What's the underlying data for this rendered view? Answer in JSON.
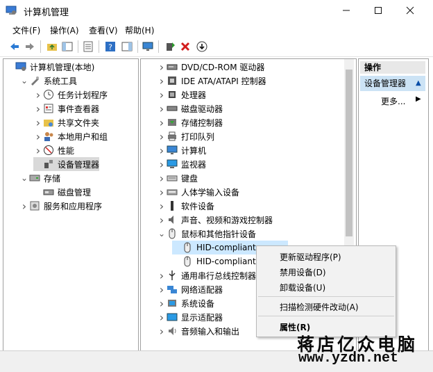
{
  "window": {
    "title": "计算机管理"
  },
  "menu": [
    "文件(F)",
    "操作(A)",
    "查看(V)",
    "帮助(H)"
  ],
  "left_tree": [
    {
      "label": "计算机管理(本地)",
      "indent": 0,
      "chev": "",
      "icon": "computer-management-icon"
    },
    {
      "label": "系统工具",
      "indent": 1,
      "chev": "v",
      "icon": "system-tools-icon"
    },
    {
      "label": "任务计划程序",
      "indent": 2,
      "chev": ">",
      "icon": "task-scheduler-icon"
    },
    {
      "label": "事件查看器",
      "indent": 2,
      "chev": ">",
      "icon": "event-viewer-icon"
    },
    {
      "label": "共享文件夹",
      "indent": 2,
      "chev": ">",
      "icon": "shared-folders-icon"
    },
    {
      "label": "本地用户和组",
      "indent": 2,
      "chev": ">",
      "icon": "local-users-icon"
    },
    {
      "label": "性能",
      "indent": 2,
      "chev": ">",
      "icon": "performance-icon"
    },
    {
      "label": "设备管理器",
      "indent": 2,
      "chev": "",
      "icon": "device-manager-icon",
      "selected": true
    },
    {
      "label": "存储",
      "indent": 1,
      "chev": "v",
      "icon": "storage-icon"
    },
    {
      "label": "磁盘管理",
      "indent": 2,
      "chev": "",
      "icon": "disk-management-icon"
    },
    {
      "label": "服务和应用程序",
      "indent": 1,
      "chev": ">",
      "icon": "services-apps-icon"
    }
  ],
  "device_tree": [
    {
      "label": "DVD/CD-ROM 驱动器",
      "chev": ">",
      "icon": "dvd-drive-icon"
    },
    {
      "label": "IDE ATA/ATAPI 控制器",
      "chev": ">",
      "icon": "ide-controller-icon"
    },
    {
      "label": "处理器",
      "chev": ">",
      "icon": "processor-icon"
    },
    {
      "label": "磁盘驱动器",
      "chev": ">",
      "icon": "disk-drive-icon"
    },
    {
      "label": "存储控制器",
      "chev": ">",
      "icon": "storage-controller-icon"
    },
    {
      "label": "打印队列",
      "chev": ">",
      "icon": "print-queue-icon"
    },
    {
      "label": "计算机",
      "chev": ">",
      "icon": "computer-icon"
    },
    {
      "label": "监视器",
      "chev": ">",
      "icon": "monitor-icon"
    },
    {
      "label": "键盘",
      "chev": ">",
      "icon": "keyboard-icon"
    },
    {
      "label": "人体学输入设备",
      "chev": ">",
      "icon": "hid-icon"
    },
    {
      "label": "软件设备",
      "chev": ">",
      "icon": "software-device-icon"
    },
    {
      "label": "声音、视频和游戏控制器",
      "chev": ">",
      "icon": "sound-icon"
    },
    {
      "label": "鼠标和其他指针设备",
      "chev": "v",
      "icon": "mouse-icon"
    },
    {
      "label": "HID-compliant",
      "chev": "",
      "icon": "mouse-icon",
      "child": true,
      "highlight": true
    },
    {
      "label": "HID-compliant",
      "chev": "",
      "icon": "mouse-icon",
      "child": true
    },
    {
      "label": "通用串行总线控制器",
      "chev": ">",
      "icon": "usb-controller-icon"
    },
    {
      "label": "网络适配器",
      "chev": ">",
      "icon": "network-adapter-icon"
    },
    {
      "label": "系统设备",
      "chev": ">",
      "icon": "system-device-icon"
    },
    {
      "label": "显示适配器",
      "chev": ">",
      "icon": "display-adapter-icon"
    },
    {
      "label": "音频输入和输出",
      "chev": ">",
      "icon": "audio-io-icon"
    }
  ],
  "actions": {
    "header": "操作",
    "item": "设备管理器",
    "more": "更多..."
  },
  "context_menu": [
    "更新驱动程序(P)",
    "禁用设备(D)",
    "卸载设备(U)",
    "扫描检测硬件改动(A)",
    "属性(R)"
  ],
  "watermark": {
    "cn": "蒋店亿众电脑",
    "url": "www.yzdn.net"
  }
}
